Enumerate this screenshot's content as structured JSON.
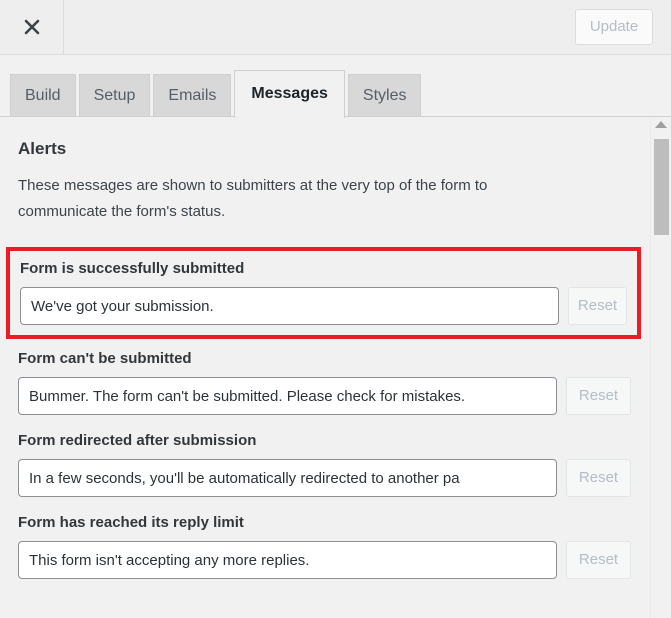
{
  "header": {
    "close_icon": "close-icon",
    "update_label": "Update"
  },
  "tabs": [
    {
      "label": "Build",
      "active": false
    },
    {
      "label": "Setup",
      "active": false
    },
    {
      "label": "Emails",
      "active": false
    },
    {
      "label": "Messages",
      "active": true
    },
    {
      "label": "Styles",
      "active": false
    }
  ],
  "content": {
    "section_title": "Alerts",
    "section_desc": "These messages are shown to submitters at the very top of the form to communicate the form's status.",
    "fields": [
      {
        "label": "Form is successfully submitted",
        "value": "We've got your submission.",
        "reset_label": "Reset",
        "highlighted": true
      },
      {
        "label": "Form can't be submitted",
        "value": "Bummer. The form can't be submitted. Please check for mistakes.",
        "reset_label": "Reset",
        "highlighted": false
      },
      {
        "label": "Form redirected after submission",
        "value": "In a few seconds, you'll be automatically redirected to another pa",
        "reset_label": "Reset",
        "highlighted": false
      },
      {
        "label": "Form has reached its reply limit",
        "value": "This form isn't accepting any more replies.",
        "reset_label": "Reset",
        "highlighted": false
      }
    ]
  },
  "scrollbar": {
    "up_arrow_icon": "triangle-up-icon"
  },
  "colors": {
    "highlight": "#ed1c24",
    "panel_bg": "#f1f1f1",
    "tab_inactive_bg": "#d8d8d8",
    "disabled_text": "#b4bdc8"
  }
}
